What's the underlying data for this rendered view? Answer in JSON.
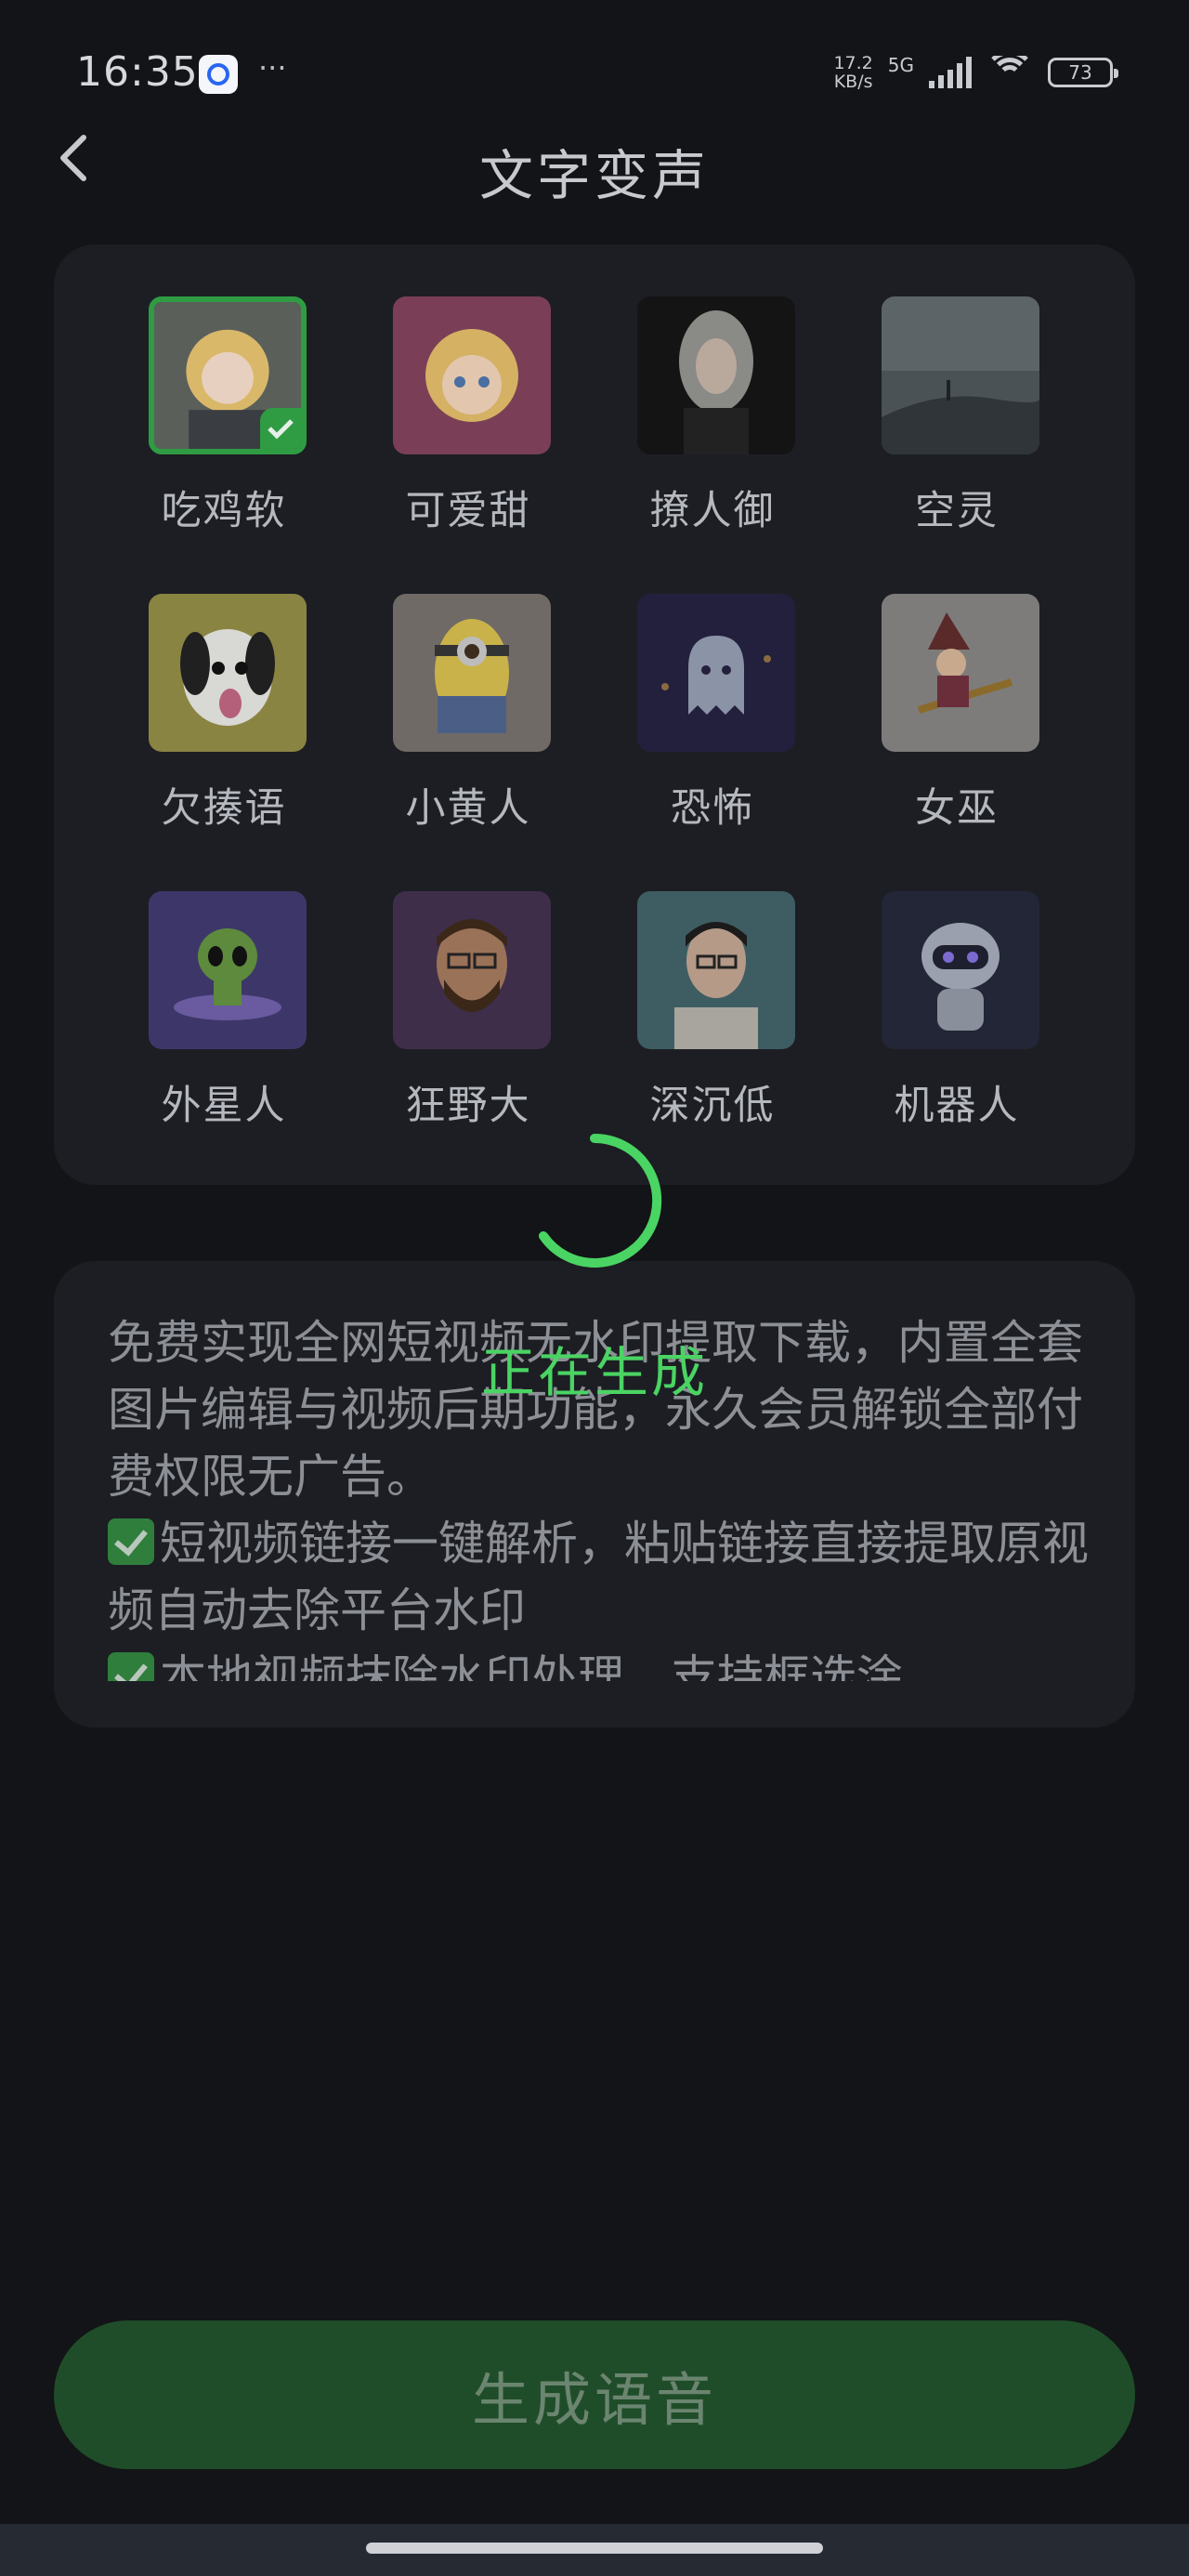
{
  "status_bar": {
    "time": "16:35",
    "dots": "···",
    "net_speed_value": "17.2",
    "net_speed_unit": "KB/s",
    "network_type": "5G",
    "battery": "73"
  },
  "header": {
    "title": "文字变声"
  },
  "voices": [
    {
      "label": "吃鸡软",
      "selected": true
    },
    {
      "label": "可爱甜",
      "selected": false
    },
    {
      "label": "撩人御",
      "selected": false
    },
    {
      "label": "空灵",
      "selected": false
    },
    {
      "label": "欠揍语",
      "selected": false
    },
    {
      "label": "小黄人",
      "selected": false
    },
    {
      "label": "恐怖",
      "selected": false
    },
    {
      "label": "女巫",
      "selected": false
    },
    {
      "label": "外星人",
      "selected": false
    },
    {
      "label": "狂野大",
      "selected": false
    },
    {
      "label": "深沉低",
      "selected": false
    },
    {
      "label": "机器人",
      "selected": false
    }
  ],
  "description": {
    "line1": "免费实现全网短视频无水印提取下载，内置全套图片编辑与视频后期功能，永久会员解锁全部付费权限无广告。",
    "line2": "短视频链接一键解析，粘贴链接直接提取原视频自动去除平台水印",
    "line3": "本地视频抹除水印处理，支持框选涂"
  },
  "loading": {
    "text": "正在生成"
  },
  "generate_button": {
    "label": "生成语音"
  },
  "colors": {
    "accent": "#4ad463",
    "button_dimmed": "#1f4d29",
    "card": "#1c1e23",
    "background": "#131417"
  }
}
